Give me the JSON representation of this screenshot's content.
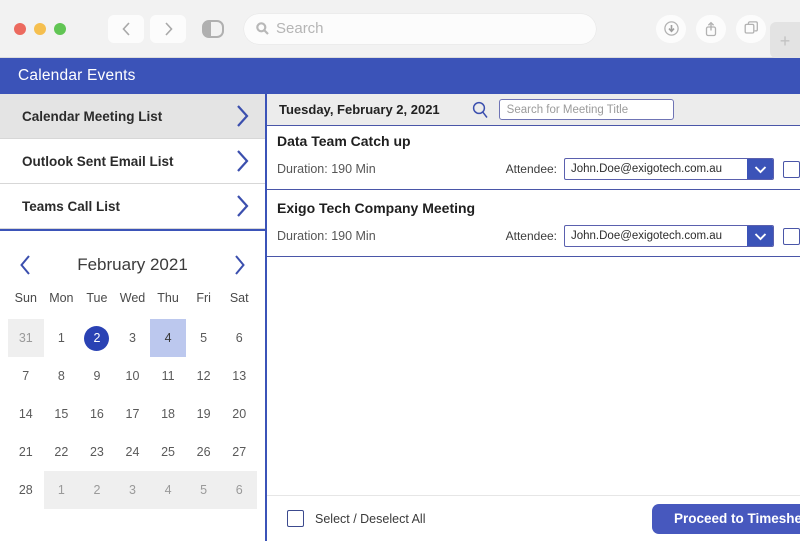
{
  "browser": {
    "search_placeholder": "Search",
    "back_icon": "chevron-left-icon",
    "forward_icon": "chevron-right-icon",
    "sidebar_icon": "sidebar-toggle-icon",
    "download_icon": "download-icon",
    "share_icon": "share-icon",
    "tabs_icon": "tab-overview-icon",
    "new_tab_label": "+"
  },
  "app": {
    "header_title": "Calendar Events",
    "accent_color": "#3b53b8"
  },
  "sidebar": {
    "items": [
      {
        "label": "Calendar Meeting List",
        "active": true
      },
      {
        "label": "Outlook Sent Email List",
        "active": false
      },
      {
        "label": "Teams Call List",
        "active": false
      }
    ]
  },
  "calendar": {
    "month_label": "February 2021",
    "prev_label": "‹",
    "next_label": "›",
    "dow": [
      "Sun",
      "Mon",
      "Tue",
      "Wed",
      "Thu",
      "Fri",
      "Sat"
    ],
    "weeks": [
      [
        {
          "d": "31",
          "state": "muted"
        },
        {
          "d": "1",
          "state": "normal"
        },
        {
          "d": "2",
          "state": "selected"
        },
        {
          "d": "3",
          "state": "normal"
        },
        {
          "d": "4",
          "state": "highlight"
        },
        {
          "d": "5",
          "state": "normal"
        },
        {
          "d": "6",
          "state": "normal"
        }
      ],
      [
        {
          "d": "7",
          "state": "normal"
        },
        {
          "d": "8",
          "state": "normal"
        },
        {
          "d": "9",
          "state": "normal"
        },
        {
          "d": "10",
          "state": "normal"
        },
        {
          "d": "11",
          "state": "normal"
        },
        {
          "d": "12",
          "state": "normal"
        },
        {
          "d": "13",
          "state": "normal"
        }
      ],
      [
        {
          "d": "14",
          "state": "normal"
        },
        {
          "d": "15",
          "state": "normal"
        },
        {
          "d": "16",
          "state": "normal"
        },
        {
          "d": "17",
          "state": "normal"
        },
        {
          "d": "18",
          "state": "normal"
        },
        {
          "d": "19",
          "state": "normal"
        },
        {
          "d": "20",
          "state": "normal"
        }
      ],
      [
        {
          "d": "21",
          "state": "normal"
        },
        {
          "d": "22",
          "state": "normal"
        },
        {
          "d": "23",
          "state": "normal"
        },
        {
          "d": "24",
          "state": "normal"
        },
        {
          "d": "25",
          "state": "normal"
        },
        {
          "d": "26",
          "state": "normal"
        },
        {
          "d": "27",
          "state": "normal"
        }
      ],
      [
        {
          "d": "28",
          "state": "normal"
        },
        {
          "d": "1",
          "state": "muted"
        },
        {
          "d": "2",
          "state": "muted"
        },
        {
          "d": "3",
          "state": "muted"
        },
        {
          "d": "4",
          "state": "muted"
        },
        {
          "d": "5",
          "state": "muted"
        },
        {
          "d": "6",
          "state": "muted"
        }
      ]
    ]
  },
  "content": {
    "date_label": "Tuesday, February 2, 2021",
    "search_icon": "search-icon",
    "search_placeholder": "Search for Meeting Title",
    "meetings": [
      {
        "title": "Data Team Catch up",
        "duration": "Duration: 190 Min",
        "attendee_label": "Attendee:",
        "attendee_value": "John.Doe@exigotech.com.au",
        "checked": false
      },
      {
        "title": "Exigo Tech Company Meeting",
        "duration": "Duration: 190 Min",
        "attendee_label": "Attendee:",
        "attendee_value": "John.Doe@exigotech.com.au",
        "checked": false
      }
    ]
  },
  "footer": {
    "select_all_label": "Select / Deselect All",
    "proceed_label": "Proceed to Timesheet"
  }
}
